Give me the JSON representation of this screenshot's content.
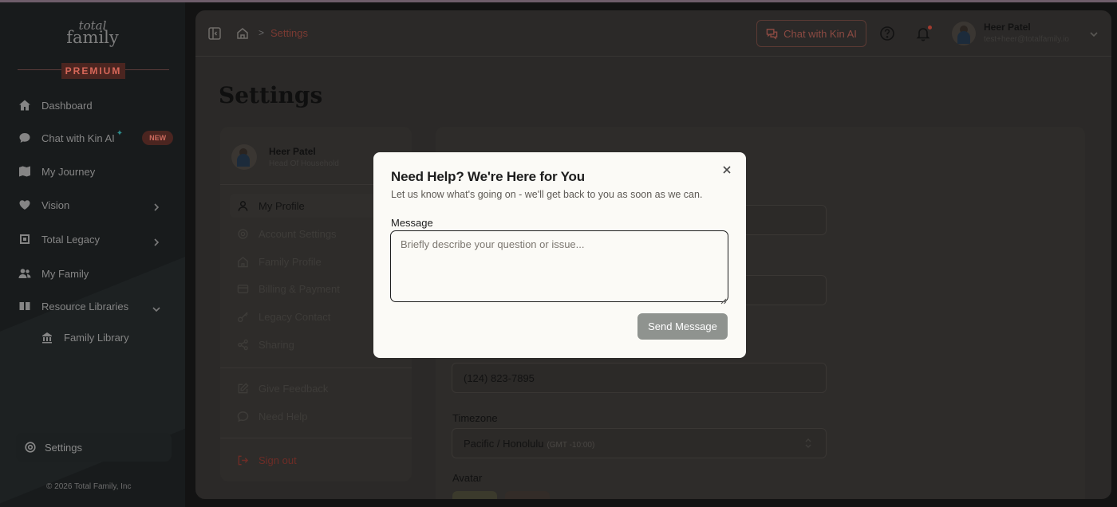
{
  "sidebar": {
    "logo_line1": "total",
    "logo_line2": "family",
    "premium_label": "PREMIUM",
    "items": [
      {
        "label": "Dashboard",
        "icon": "home-icon"
      },
      {
        "label": "Chat with Kin AI",
        "icon": "chat-bubble-icon",
        "badge": "NEW"
      },
      {
        "label": "My Journey",
        "icon": "map-icon"
      },
      {
        "label": "Vision",
        "icon": "heart-icon"
      },
      {
        "label": "Total Legacy",
        "icon": "legacy-icon"
      },
      {
        "label": "My Family",
        "icon": "users-icon"
      },
      {
        "label": "Resource Libraries",
        "icon": "book-icon"
      },
      {
        "label": "Family Library",
        "icon": "library-icon"
      }
    ],
    "settings_label": "Settings",
    "copyright": "© 2026 Total Family, Inc"
  },
  "topbar": {
    "breadcrumb_current": "Settings",
    "breadcrumb_separator": ">",
    "chat_button_label": "Chat with Kin AI",
    "user_name": "Heer Patel",
    "user_email": "test+heer@totalfamily.io"
  },
  "page": {
    "title": "Settings"
  },
  "settings_menu": {
    "user_name": "Heer Patel",
    "user_role": "Head Of Household",
    "items": [
      {
        "label": "My Profile",
        "icon": "user-icon"
      },
      {
        "label": "Account Settings",
        "icon": "gear-icon"
      },
      {
        "label": "Family Profile",
        "icon": "house-icon"
      },
      {
        "label": "Billing & Payment",
        "icon": "credit-card-icon"
      },
      {
        "label": "Legacy Contact",
        "icon": "key-icon"
      },
      {
        "label": "Sharing",
        "icon": "share-icon"
      }
    ],
    "secondary_items": [
      {
        "label": "Give Feedback",
        "icon": "edit-icon"
      },
      {
        "label": "Need Help",
        "icon": "message-icon"
      }
    ],
    "sign_out_label": "Sign out"
  },
  "profile_form": {
    "phone_value": "(124) 823-7895",
    "timezone_label": "Timezone",
    "timezone_value": "Pacific / Honolulu",
    "timezone_offset": "(GMT -10:00)",
    "avatar_label": "Avatar"
  },
  "modal": {
    "title": "Need Help? We're Here for You",
    "subtitle": "Let us know what's going on - we'll get back to you as soon as we can.",
    "message_label": "Message",
    "message_placeholder": "Briefly describe your question or issue...",
    "send_button_label": "Send Message"
  },
  "colors": {
    "accent": "#8b4a42",
    "send_button": "#8f938f",
    "modal_bg": "#fbfaf6"
  }
}
